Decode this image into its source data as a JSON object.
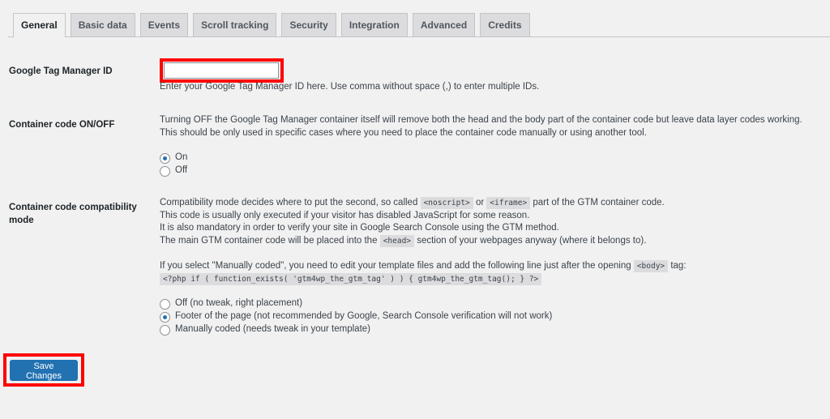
{
  "tabs": [
    "General",
    "Basic data",
    "Events",
    "Scroll tracking",
    "Security",
    "Integration",
    "Advanced",
    "Credits"
  ],
  "gtm_id": {
    "label": "Google Tag Manager ID",
    "value": "",
    "help": "Enter your Google Tag Manager ID here. Use comma without space (,) to enter multiple IDs."
  },
  "container": {
    "label": "Container code ON/OFF",
    "lines": [
      "Turning OFF the Google Tag Manager container itself will remove both the head and the body part of the container code but leave data layer codes working.",
      "This should be only used in specific cases where you need to place the container code manually or using another tool."
    ],
    "options": [
      "On",
      "Off"
    ],
    "selected": "On"
  },
  "compat": {
    "label": "Container code compatibility mode",
    "l1a": "Compatibility mode decides where to put the second, so called",
    "c1": "<noscript>",
    "l1b": "or",
    "c2": "<iframe>",
    "l1c": "part of the GTM container code.",
    "l2": "This code is usually only executed if your visitor has disabled JavaScript for some reason.",
    "l3": "It is also mandatory in order to verify your site in Google Search Console using the GTM method.",
    "l4a": "The main GTM container code will be placed into the",
    "c3": "<head>",
    "l4b": "section of your webpages anyway (where it belongs to).",
    "l5a": "If you select \"Manually coded\", you need to edit your template files and add the following line just after the opening",
    "c4": "<body>",
    "l5b": "tag:",
    "code": "<?php if ( function_exists( 'gtm4wp_the_gtm_tag' ) ) { gtm4wp_the_gtm_tag(); } ?>",
    "options": [
      "Off (no tweak, right placement)",
      "Footer of the page (not recommended by Google, Search Console verification will not work)",
      "Manually coded (needs tweak in your template)"
    ],
    "selected": 1
  },
  "save_label": "Save Changes",
  "accent": "#2271b1"
}
